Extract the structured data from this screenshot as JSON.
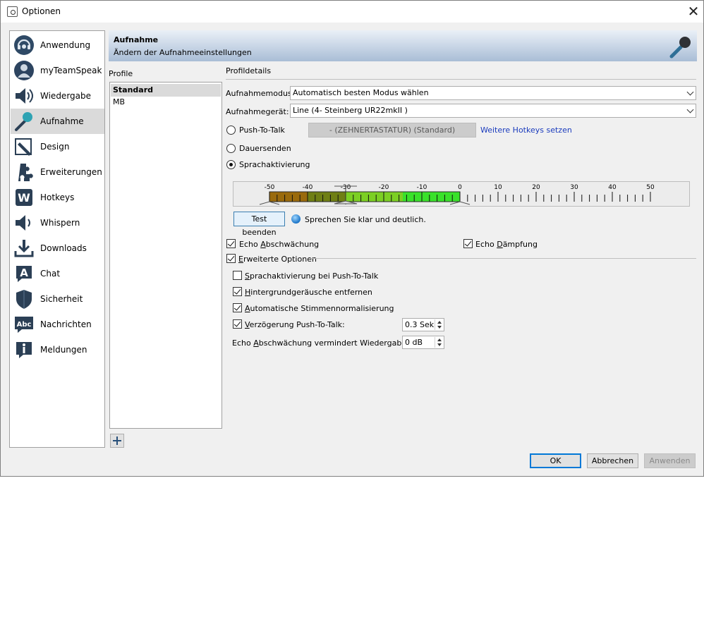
{
  "window": {
    "title": "Optionen"
  },
  "sidebar": {
    "items": [
      {
        "label": "Anwendung",
        "icon": "headset-icon"
      },
      {
        "label": "myTeamSpeak",
        "icon": "user-icon"
      },
      {
        "label": "Wiedergabe",
        "icon": "speaker-icon"
      },
      {
        "label": "Aufnahme",
        "icon": "microphone-icon",
        "active": true
      },
      {
        "label": "Design",
        "icon": "pencil-icon"
      },
      {
        "label": "Erweiterungen",
        "icon": "puzzle-icon"
      },
      {
        "label": "Hotkeys",
        "icon": "keyboard-w-icon"
      },
      {
        "label": "Whispern",
        "icon": "whisper-speaker-icon"
      },
      {
        "label": "Downloads",
        "icon": "download-icon"
      },
      {
        "label": "Chat",
        "icon": "chat-a-icon"
      },
      {
        "label": "Sicherheit",
        "icon": "shield-icon"
      },
      {
        "label": "Nachrichten",
        "icon": "abc-message-icon"
      },
      {
        "label": "Meldungen",
        "icon": "info-icon"
      }
    ]
  },
  "header": {
    "title": "Aufnahme",
    "subtitle": "Ändern der Aufnahmeeinstellungen",
    "icon": "microphone-icon"
  },
  "profiles": {
    "label": "Profile",
    "items": [
      "Standard",
      "MB"
    ],
    "selected": "Standard"
  },
  "details": {
    "section_label": "Profildetails",
    "mode_label": "Aufnahmemodus:",
    "mode_value": "Automatisch besten Modus wählen",
    "device_label": "Aufnahmegerät:",
    "device_value": "Line (4- Steinberg UR22mkII )",
    "ptt_label": "Push-To-Talk",
    "ptt_hotkey": "- (ZEHNERTASTATUR) (Standard)",
    "more_hotkeys": "Weitere Hotkeys setzen",
    "continuous_label": "Dauersenden",
    "voice_label": "Sprachaktivierung",
    "selected_mode": "Sprachaktivierung"
  },
  "meter": {
    "scale_labels": [
      "-50",
      "-40",
      "-30",
      "-20",
      "-10",
      "0",
      "10",
      "20",
      "30",
      "40",
      "50"
    ],
    "range": [
      -50,
      50
    ],
    "level_db": 0,
    "threshold_db": -30,
    "colors": {
      "low": "#9a6a0c",
      "mid": "#7ccf23",
      "high": "#39e12a"
    }
  },
  "test": {
    "button_label": "Test beenden",
    "message": "Sprechen Sie klar und deutlich."
  },
  "options": {
    "echo_reduction": {
      "label": "Echo Abschwächung",
      "checked": true
    },
    "echo_damping": {
      "label": "Echo Dämpfung",
      "checked": true
    },
    "advanced": {
      "label": "Erweiterte Optionen",
      "checked": true
    },
    "voice_ptt": {
      "label": "Sprachaktivierung bei Push-To-Talk",
      "checked": false
    },
    "noise_removal": {
      "label": "Hintergrundgeräusche entfernen",
      "checked": true
    },
    "auto_normalize": {
      "label": "Automatische Stimmennormalisierung",
      "checked": true
    },
    "ptt_delay": {
      "label": "Verzögerung Push-To-Talk:",
      "checked": true,
      "value": "0.3 Sek"
    },
    "echo_playback": {
      "label": "Echo Abschwächung vermindert Wiedergabe um:",
      "value": "0 dB"
    }
  },
  "buttons": {
    "ok": "OK",
    "cancel": "Abbrechen",
    "apply": "Anwenden"
  }
}
